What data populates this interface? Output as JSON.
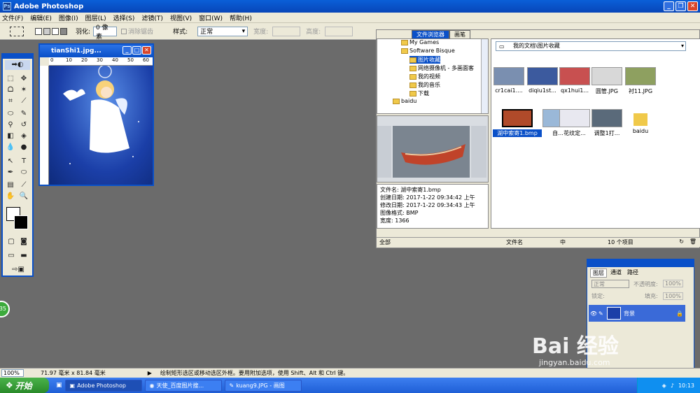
{
  "app": {
    "title": "Adobe Photoshop"
  },
  "menu": [
    "文件(F)",
    "编辑(E)",
    "图像(I)",
    "图层(L)",
    "选择(S)",
    "滤镜(T)",
    "视图(V)",
    "窗口(W)",
    "帮助(H)"
  ],
  "options": {
    "feather_label": "羽化:",
    "feather_value": "0 像素",
    "antialias_label": "消除锯齿",
    "style_label": "样式:",
    "style_value": "正常",
    "width_label": "宽度:",
    "height_label": "高度:"
  },
  "document": {
    "title": "tianShi1.jpg...",
    "ruler_marks": [
      "0",
      "10",
      "20",
      "30",
      "40",
      "50",
      "60"
    ]
  },
  "browser": {
    "tabs": [
      "文件浏览器",
      "画笔"
    ],
    "path": "我的文档\\图片收藏",
    "tree": [
      "My Games",
      "Software Bisque",
      "图片收藏",
      "网络摄像机 - 多画面客",
      "我的视频",
      "我的音乐",
      "下载",
      "baidu"
    ],
    "meta": [
      "文件名: 湖中索寄1.bmp",
      "创建日期: 2017-1-22 09:34:42 上午",
      "修改日期: 2017-1-22 09:34:43 上午",
      "图像格式: BMP",
      "宽度: 1366"
    ],
    "thumbnails": [
      {
        "label": "cr1cai1....",
        "color": "#7a8fb0"
      },
      {
        "label": "diqiu1st...",
        "color": "#3c5a9e"
      },
      {
        "label": "qx1hui1...",
        "color": "#c85050"
      },
      {
        "label": "圆管.JPG",
        "color": "#d8d8d8"
      },
      {
        "label": "衬11.JPG",
        "color": "#8ea060"
      },
      {
        "label": "湖中索寄1.bmp",
        "color": "#b04a2a"
      },
      {
        "label": "自...",
        "color": "#9ab8d8"
      },
      {
        "label": "花纹定...",
        "color": "#e8e8f0"
      },
      {
        "label": "调整1打...",
        "color": "#5a6a7a"
      },
      {
        "label": "baidu",
        "color": "#f0c94a"
      }
    ],
    "status_left": "全部",
    "status_sort": "文件名",
    "status_size": "中",
    "status_count": "10 个项目"
  },
  "layers": {
    "tabs": [
      "图层",
      "通道",
      "路径"
    ],
    "blend": "正常",
    "opacity_label": "不透明度:",
    "opacity_value": "100%",
    "lock_label": "锁定:",
    "fill_label": "填充:",
    "fill_value": "100%",
    "layer_name": "背景"
  },
  "status": {
    "zoom": "100%",
    "size": "71.97 毫米 x 81.84 毫米",
    "hint": "绘制矩形选区或移动选区外框。要用附加选项，使用 Shift、Alt 和 Ctrl 键。"
  },
  "taskbar": {
    "start": "开始",
    "tasks": [
      "Adobe Photoshop",
      "天使_百度图片搜...",
      "kuang9.JPG - 画图"
    ],
    "clock": "10:13"
  },
  "watermark": {
    "line1": "Bai 经验",
    "line2": "jingyan.baidu.com"
  },
  "badge": "35"
}
